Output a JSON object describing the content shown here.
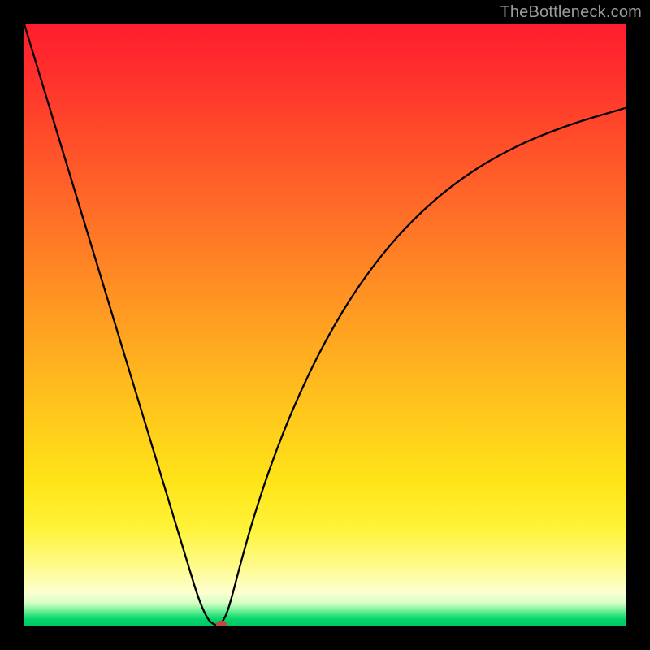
{
  "watermark": "TheBottleneck.com",
  "marker_color": "#c24b3f",
  "chart_data": {
    "type": "line",
    "title": "",
    "xlabel": "",
    "ylabel": "",
    "xlim": [
      0,
      100
    ],
    "ylim": [
      0,
      100
    ],
    "grid": false,
    "legend": false,
    "annotations": [],
    "x": [
      0,
      4,
      8,
      12,
      16,
      20,
      24,
      27,
      29,
      30.5,
      31.5,
      32,
      33,
      34,
      36,
      38,
      41,
      45,
      50,
      56,
      63,
      71,
      80,
      90,
      100
    ],
    "values": [
      100,
      86.8,
      73.6,
      60.4,
      47.2,
      34.0,
      20.8,
      10.9,
      4.3,
      1.0,
      0.2,
      0.1,
      0.6,
      2.8,
      10.5,
      17.6,
      26.8,
      37.0,
      47.4,
      57.3,
      66.0,
      73.3,
      79.0,
      83.2,
      86.1
    ],
    "marker": {
      "x": 32.8,
      "y": 0.1
    },
    "background_gradient": {
      "direction": "vertical",
      "stops": [
        {
          "pos": 0.0,
          "color": "#ff1d2d"
        },
        {
          "pos": 0.3,
          "color": "#ff6a28"
        },
        {
          "pos": 0.6,
          "color": "#ffcb1c"
        },
        {
          "pos": 0.85,
          "color": "#fff33a"
        },
        {
          "pos": 0.95,
          "color": "#fcffd0"
        },
        {
          "pos": 1.0,
          "color": "#02c763"
        }
      ]
    }
  }
}
